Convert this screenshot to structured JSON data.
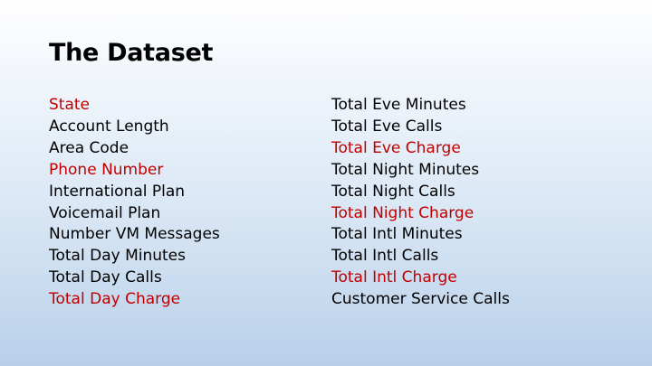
{
  "title": "The Dataset",
  "colors": {
    "normal": "#000000",
    "highlight": "#c00000"
  },
  "left_column": [
    {
      "text": "State",
      "highlight": true
    },
    {
      "text": "Account Length",
      "highlight": false
    },
    {
      "text": "Area Code",
      "highlight": false
    },
    {
      "text": "Phone Number",
      "highlight": true
    },
    {
      "text": "International Plan",
      "highlight": false
    },
    {
      "text": "Voicemail Plan",
      "highlight": false
    },
    {
      "text": "Number VM Messages",
      "highlight": false
    },
    {
      "text": "Total Day Minutes",
      "highlight": false
    },
    {
      "text": "Total Day Calls",
      "highlight": false
    },
    {
      "text": "Total Day Charge",
      "highlight": true
    }
  ],
  "right_column": [
    {
      "text": "Total Eve Minutes",
      "highlight": false
    },
    {
      "text": "Total Eve Calls",
      "highlight": false
    },
    {
      "text": "Total Eve Charge",
      "highlight": true
    },
    {
      "text": "Total Night Minutes",
      "highlight": false
    },
    {
      "text": "Total Night Calls",
      "highlight": false
    },
    {
      "text": "Total Night Charge",
      "highlight": true
    },
    {
      "text": "Total Intl Minutes",
      "highlight": false
    },
    {
      "text": "Total Intl Calls",
      "highlight": false
    },
    {
      "text": "Total Intl Charge",
      "highlight": true
    },
    {
      "text": "Customer Service Calls",
      "highlight": false
    }
  ]
}
